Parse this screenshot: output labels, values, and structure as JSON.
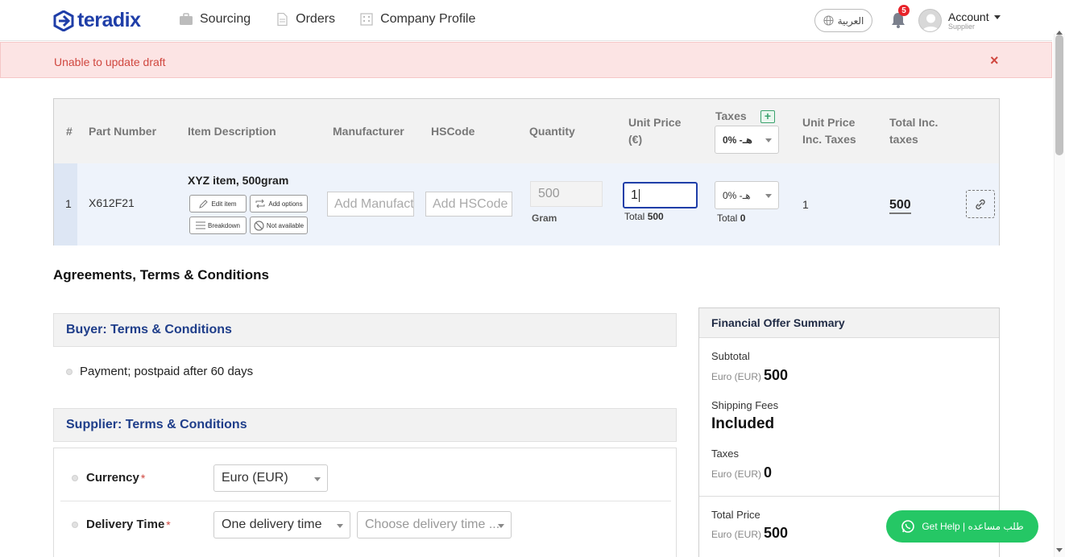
{
  "brand": {
    "name": "teradix",
    "color": "#1f3ea8"
  },
  "nav": [
    {
      "label": "Sourcing",
      "icon": "briefcase-icon"
    },
    {
      "label": "Orders",
      "icon": "document-icon"
    },
    {
      "label": "Company Profile",
      "icon": "building-icon"
    }
  ],
  "header": {
    "language_label": "العربية",
    "notification_count": "5",
    "account_label": "Account",
    "account_role": "Supplier"
  },
  "alert": {
    "message": "Unable to update draft",
    "close": "×"
  },
  "items_table": {
    "headers": {
      "index": "#",
      "part_number": "Part Number",
      "item_description": "Item Description",
      "manufacturer": "Manufacturer",
      "hscode": "HSCode",
      "quantity": "Quantity",
      "unit_price_1": "Unit Price",
      "unit_price_2": "(€)",
      "taxes": "Taxes",
      "unit_price_inc_1": "Unit Price",
      "unit_price_inc_2": "Inc. Taxes",
      "total_inc_1": "Total Inc.",
      "total_inc_2": "taxes"
    },
    "header_tax_select": "0% -ﻫـ",
    "add_tax": "+",
    "row": {
      "index": "1",
      "part_number": "X612F21",
      "item_title": "XYZ item, 500gram",
      "buttons": {
        "edit": "Edit item",
        "add_options": "Add options",
        "breakdown": "Breakdown",
        "not_available": "Not available"
      },
      "manufacturer_placeholder": "Add Manufacturer",
      "hscode_placeholder": "Add HSCode",
      "quantity": "500",
      "unit": "Gram",
      "unit_price": "1",
      "price_total_label": "Total",
      "price_total_value": "500",
      "tax_select": "0% -ﻫـ",
      "tax_total_label": "Total",
      "tax_total_value": "0",
      "unit_price_inc": "1",
      "total_inc": "500"
    }
  },
  "agreements": {
    "title": "Agreements, Terms & Conditions",
    "buyer_heading": "Buyer: Terms & Conditions",
    "buyer_terms": [
      "Payment; postpaid after 60 days"
    ],
    "supplier_heading": "Supplier: Terms & Conditions",
    "currency_label": "Currency",
    "currency_value": "Euro (EUR)",
    "delivery_label": "Delivery Time",
    "delivery_value": "One delivery time",
    "delivery_placeholder": "Choose delivery time ...",
    "required_mark": "*"
  },
  "financial_summary": {
    "title": "Financial Offer Summary",
    "subtotal_label": "Subtotal",
    "subtotal_currency": "Euro (EUR)",
    "subtotal_value": "500",
    "shipping_label": "Shipping Fees",
    "shipping_value": "Included",
    "taxes_label": "Taxes",
    "taxes_currency": "Euro (EUR)",
    "taxes_value": "0",
    "total_label": "Total Price",
    "total_currency": "Euro (EUR)",
    "total_value": "500"
  },
  "help": {
    "label": "Get Help | طلب مساعده",
    "color": "#25c765"
  },
  "colors": {
    "alert_bg": "#fce4e4",
    "alert_text": "#d0473f",
    "focus_border": "#1f3ea8"
  }
}
